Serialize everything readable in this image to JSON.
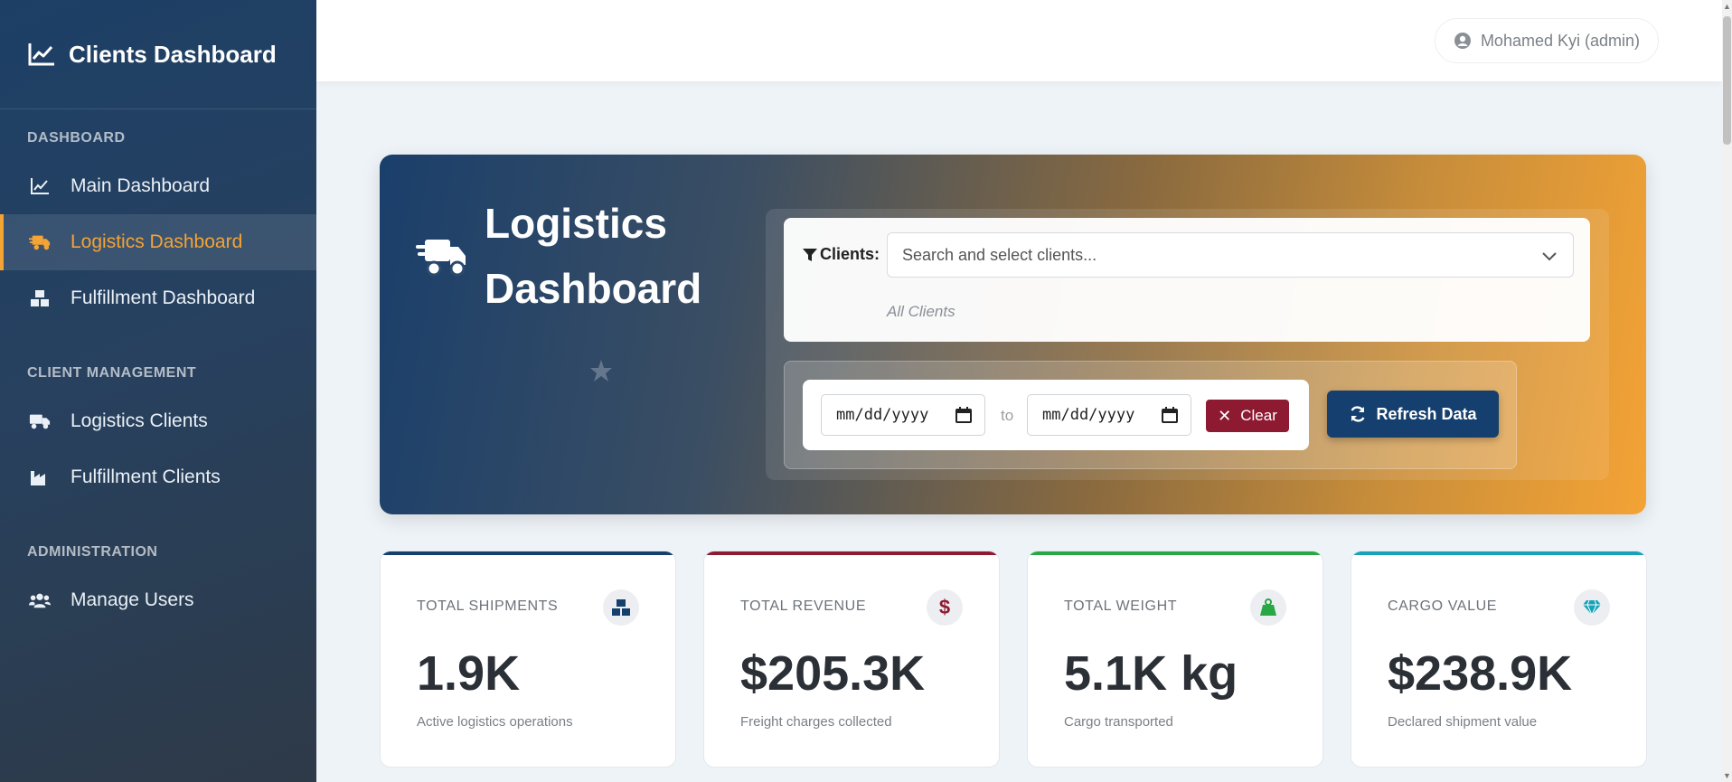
{
  "sidebar": {
    "brand": "Clients Dashboard",
    "sections": [
      {
        "title": "DASHBOARD"
      },
      {
        "title": "CLIENT MANAGEMENT"
      },
      {
        "title": "ADMINISTRATION"
      }
    ],
    "items": [
      {
        "label": "Main Dashboard",
        "icon": "chart-line-icon"
      },
      {
        "label": "Logistics Dashboard",
        "icon": "truck-fast-icon",
        "active": true
      },
      {
        "label": "Fulfillment Dashboard",
        "icon": "boxes-icon"
      },
      {
        "label": "Logistics Clients",
        "icon": "truck-icon"
      },
      {
        "label": "Fulfillment Clients",
        "icon": "industry-icon"
      },
      {
        "label": "Manage Users",
        "icon": "users-icon"
      }
    ]
  },
  "topbar": {
    "user": "Mohamed Kyi (admin)"
  },
  "hero": {
    "title": "Logistics Dashboard",
    "clients_label": "Clients:",
    "clients_placeholder": "Search and select clients...",
    "clients_hint": "All Clients",
    "date_from_placeholder": "mm/dd/yyyy",
    "date_to_placeholder": "mm/dd/yyyy",
    "to_label": "to",
    "clear_label": "Clear",
    "refresh_label": "Refresh Data"
  },
  "colors": {
    "accent": "#f4a335",
    "primary": "#143f6e",
    "danger": "#8e1a32",
    "success": "#28a745",
    "info": "#17a2b8"
  },
  "stats": [
    {
      "label": "TOTAL SHIPMENTS",
      "value": "1.9K",
      "sub": "Active logistics operations",
      "icon": "boxes-icon",
      "color": "#143f6e"
    },
    {
      "label": "TOTAL REVENUE",
      "value": "$205.3K",
      "sub": "Freight charges collected",
      "icon": "dollar-icon",
      "color": "#8e1a32"
    },
    {
      "label": "TOTAL WEIGHT",
      "value": "5.1K kg",
      "sub": "Cargo transported",
      "icon": "weight-icon",
      "color": "#28a745"
    },
    {
      "label": "CARGO VALUE",
      "value": "$238.9K",
      "sub": "Declared shipment value",
      "icon": "gem-icon",
      "color": "#17a2b8"
    }
  ]
}
